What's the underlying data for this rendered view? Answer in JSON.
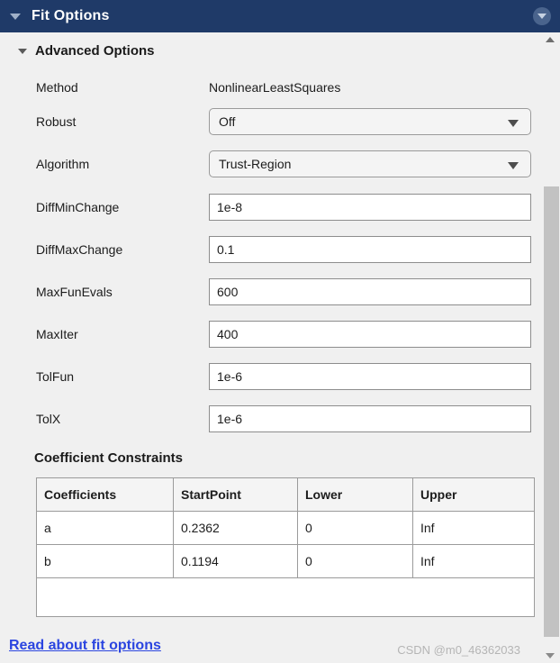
{
  "titlebar": {
    "title": "Fit Options",
    "collapse_icon": "triangle-down-icon",
    "help_icon": "circle-chevron-down-icon"
  },
  "section": {
    "expander_icon": "triangle-down-icon",
    "title": "Advanced Options"
  },
  "rows": [
    {
      "label": "Method",
      "type": "static",
      "value": "NonlinearLeastSquares"
    },
    {
      "label": "Robust",
      "type": "combo",
      "value": "Off"
    },
    {
      "label": "Algorithm",
      "type": "combo",
      "value": "Trust-Region"
    },
    {
      "label": "DiffMinChange",
      "type": "text",
      "value": "1e-8"
    },
    {
      "label": "DiffMaxChange",
      "type": "text",
      "value": "0.1"
    },
    {
      "label": "MaxFunEvals",
      "type": "text",
      "value": "600"
    },
    {
      "label": "MaxIter",
      "type": "text",
      "value": "400"
    },
    {
      "label": "TolFun",
      "type": "text",
      "value": "1e-6"
    },
    {
      "label": "TolX",
      "type": "text",
      "value": "1e-6"
    }
  ],
  "coefficient_constraints": {
    "heading": "Coefficient Constraints",
    "columns": [
      "Coefficients",
      "StartPoint",
      "Lower",
      "Upper"
    ],
    "rows": [
      [
        "a",
        "0.2362",
        "0",
        "Inf"
      ],
      [
        "b",
        "0.1194",
        "0",
        "Inf"
      ]
    ],
    "empty_row": [
      "",
      "",
      "",
      ""
    ]
  },
  "footer": {
    "link_label": "Read about fit options",
    "watermark": "CSDN @m0_46362033"
  },
  "scrollbar": {
    "up_icon": "triangle-up-icon",
    "down_icon": "triangle-down-icon"
  },
  "colors": {
    "titlebar_bg": "#1f3a68",
    "panel_bg": "#f0f0f0",
    "link": "#2b45e0",
    "field_border": "#8d8d8d"
  }
}
